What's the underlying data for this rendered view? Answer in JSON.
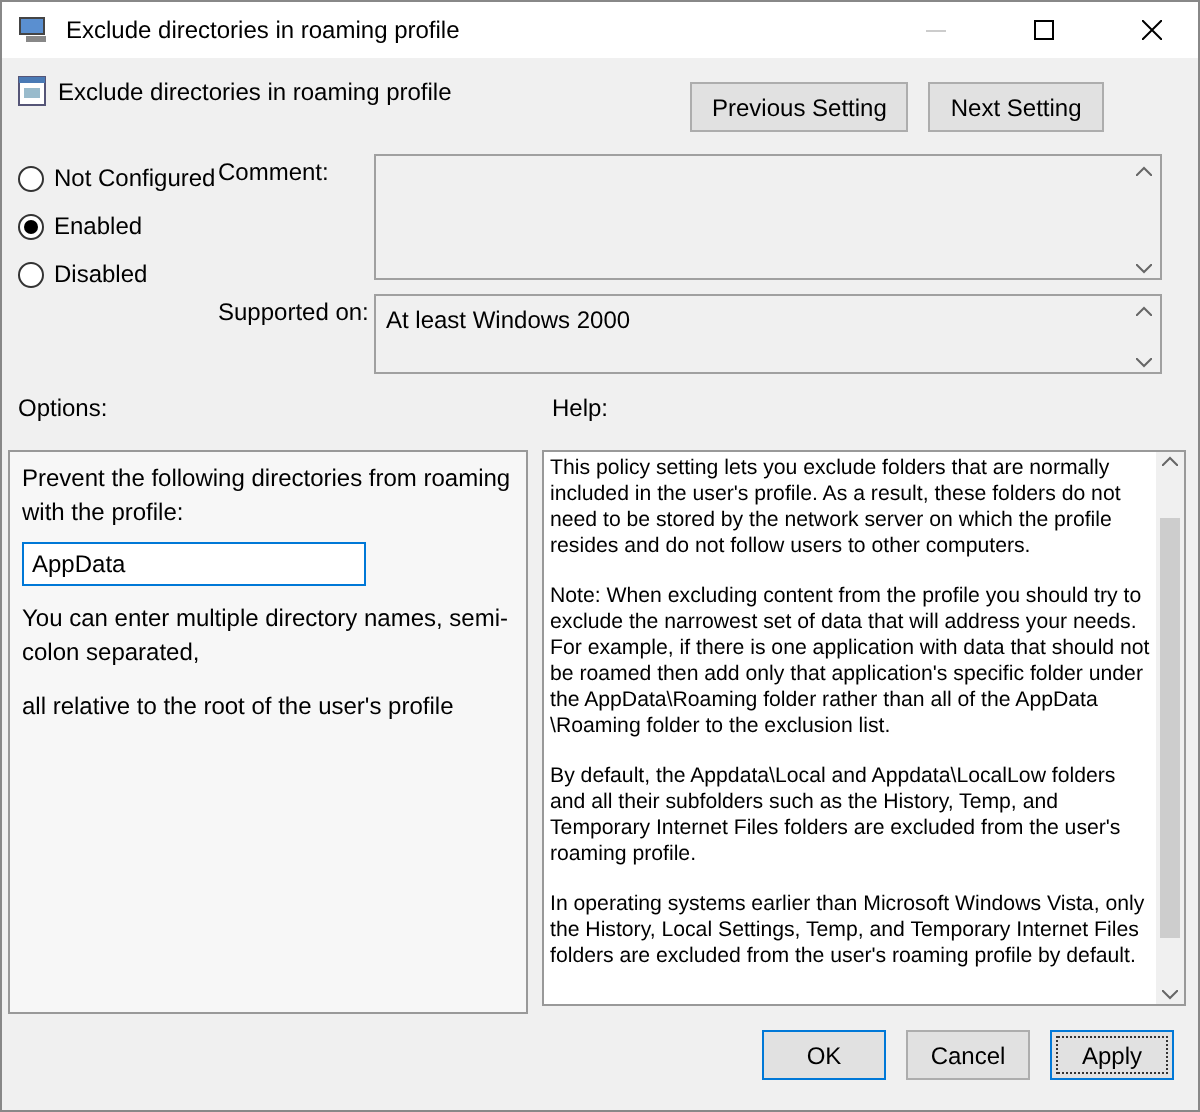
{
  "window": {
    "title": "Exclude directories in roaming profile"
  },
  "header": {
    "title": "Exclude directories in roaming profile",
    "buttons": [
      "Previous Setting",
      "Next Setting"
    ]
  },
  "state_options": [
    {
      "label": "Not Configured",
      "selected": false
    },
    {
      "label": "Enabled",
      "selected": true
    },
    {
      "label": "Disabled",
      "selected": false
    }
  ],
  "comment": {
    "label": "Comment:"
  },
  "supported_on": {
    "label": "Supported on:",
    "value": "At least Windows 2000"
  },
  "options": {
    "label": "Options:",
    "prompt": "Prevent the following directories from roaming with the profile:",
    "value": "AppData",
    "notes": [
      "You can enter multiple directory names, semi-colon separated,",
      "all relative to the root of the user's profile"
    ]
  },
  "help": {
    "label": "Help:",
    "paragraphs": [
      "This policy setting lets you exclude folders that are normally included in the user's profile. As a result, these folders do not need to be stored by the network server on which the profile resides and do not follow users to other computers.",
      "Note: When excluding content from the profile you should try to exclude the narrowest set of data that will address your needs. For example, if there is one application with data that should not be roamed then add only that application's specific folder under the AppData\\Roaming folder rather than all of the AppData \\Roaming folder to the exclusion list.",
      "By default, the Appdata\\Local and Appdata\\LocalLow folders and all their subfolders such as the History, Temp, and Temporary Internet Files folders are excluded from the user's roaming profile.",
      "In operating systems earlier than Microsoft Windows Vista, only the History, Local Settings, Temp, and Temporary Internet Files folders are excluded from the user's roaming profile by default."
    ]
  },
  "footer_buttons": [
    {
      "label": "OK",
      "default": true,
      "focused": false
    },
    {
      "label": "Cancel",
      "default": false,
      "focused": false
    },
    {
      "label": "Apply",
      "default": false,
      "focused": true
    }
  ]
}
